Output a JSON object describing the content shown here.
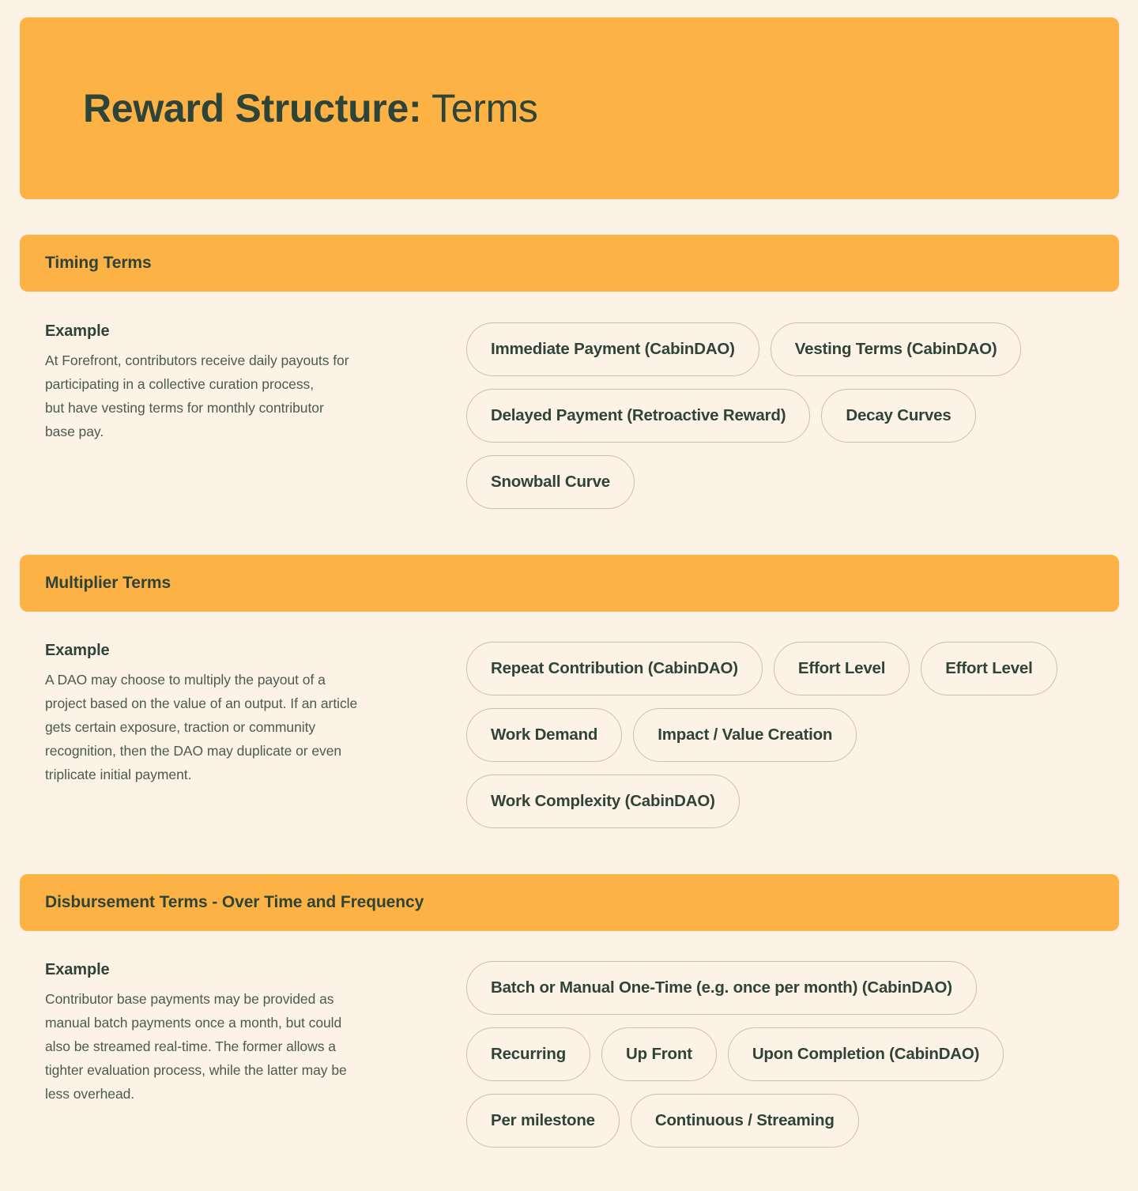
{
  "theme": {
    "page_background": "#fdf2e6",
    "accent_orange": "#fcb244",
    "text_dark_green": "#2f4438",
    "body_text": "#4a5b50",
    "pill_border": "#cbbfb0"
  },
  "title": {
    "strong": "Reward Structure:",
    "light": " Terms"
  },
  "sections": [
    {
      "header": "Timing Terms",
      "example_label": "Example",
      "example_body": "At Forefront, contributors receive daily payouts for\nparticipating in a collective curation process,\nbut have vesting terms for monthly contributor\nbase pay.",
      "pills": [
        "Immediate Payment (CabinDAO)",
        "Vesting Terms (CabinDAO)",
        "Delayed Payment (Retroactive Reward)",
        "Decay Curves",
        "Snowball Curve"
      ]
    },
    {
      "header": "Multiplier Terms",
      "example_label": "Example",
      "example_body": "A DAO may choose to multiply the payout of a\nproject based on the value of an output. If an article\ngets certain exposure, traction or community\nrecognition, then the DAO may duplicate or even\ntriplicate initial payment.",
      "pills": [
        "Repeat Contribution (CabinDAO)",
        "Effort Level",
        "Effort Level",
        "Work Demand",
        "Impact / Value Creation",
        "Work Complexity (CabinDAO)"
      ]
    },
    {
      "header": "Disbursement Terms - Over Time and Frequency",
      "example_label": "Example",
      "example_body": "Contributor base payments may be provided as\nmanual batch payments once a month, but could\nalso be streamed real-time. The former allows a\ntighter evaluation process, while the latter may be\nless overhead.",
      "pills": [
        "Batch or Manual One-Time (e.g. once per month) (CabinDAO)",
        "Recurring",
        "Up Front",
        "Upon Completion (CabinDAO)",
        "Per milestone",
        "Continuous / Streaming"
      ]
    }
  ]
}
